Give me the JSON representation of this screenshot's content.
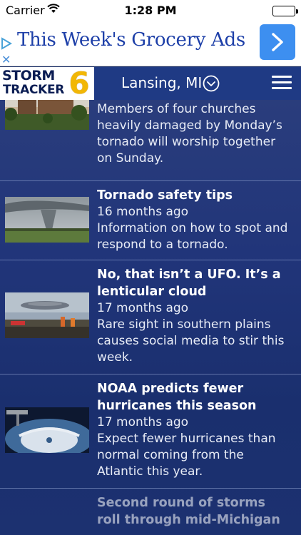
{
  "status_bar": {
    "carrier": "Carrier",
    "time": "1:28 PM"
  },
  "ad": {
    "text": "This Week's Grocery Ads",
    "close_glyph": "✕"
  },
  "header": {
    "logo_line1": "STORM",
    "logo_line2": "TRACKER",
    "logo_number": "6",
    "location": "Lansing, MI"
  },
  "colors": {
    "accent": "#1f3a84",
    "ad_blue": "#3d8ff0",
    "logo_gold": "#f2b705"
  },
  "feed": {
    "items": [
      {
        "title": "",
        "time": "",
        "description": "Members of four churches heavily damaged by Monday’s tornado will worship together on Sunday."
      },
      {
        "title": "Tornado safety tips",
        "time": "16 months ago",
        "description": "Information on how to spot and respond to a tornado."
      },
      {
        "title": "No, that isn’t a UFO. It’s a lenticular cloud",
        "time": "17 months ago",
        "description": "Rare sight in southern plains causes social media to stir this week."
      },
      {
        "title": "NOAA predicts fewer hurricanes this season",
        "time": "17 months ago",
        "description": "Expect fewer hurricanes than normal coming from the Atlantic this year."
      },
      {
        "title": "Second round of storms roll through mid-Michigan",
        "time": "",
        "description": ""
      }
    ]
  }
}
